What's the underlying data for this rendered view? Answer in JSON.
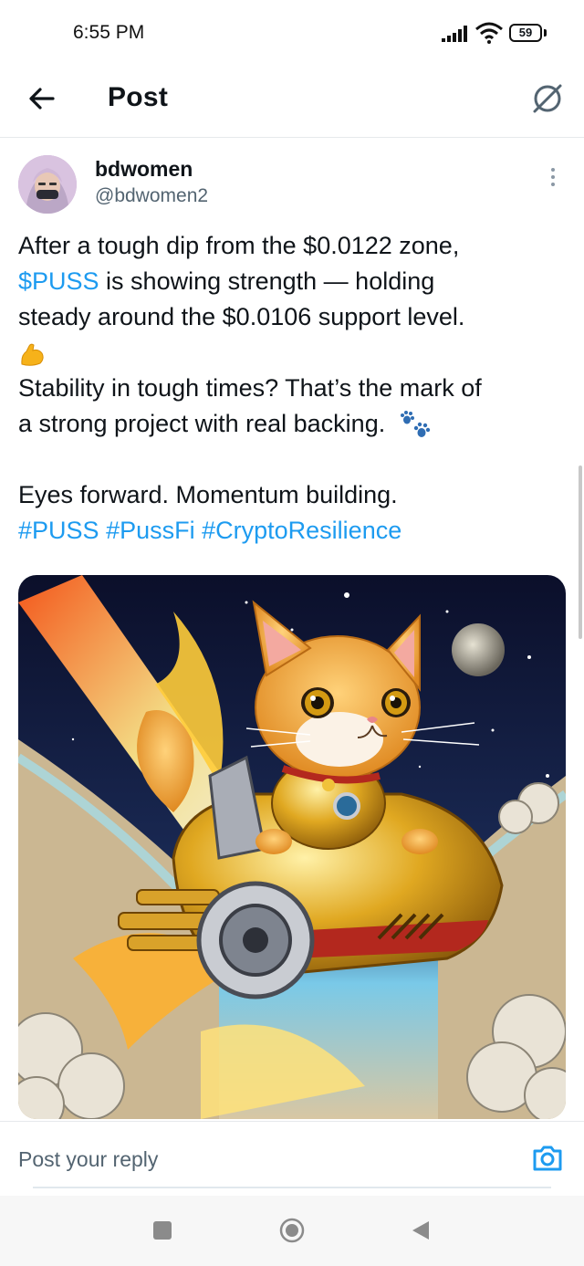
{
  "status_bar": {
    "time": "6:55 PM",
    "battery": "59"
  },
  "header": {
    "title": "Post"
  },
  "author": {
    "name": "bdwomen",
    "handle": "@bdwomen2"
  },
  "tweet": {
    "line1": "After a tough dip from the $0.0122 zone,",
    "cashtag": "$PUSS",
    "line2_rest": " is showing strength — holding",
    "line3": "steady around the $0.0106 support level.",
    "line4": "Stability in tough times? That’s the mark of",
    "line5": "a strong project with real backing.",
    "line6": "Eyes forward. Momentum building.",
    "hashtags": [
      "#PUSS",
      "#PussFi",
      "#CryptoResilience"
    ]
  },
  "reply": {
    "placeholder": "Post your reply"
  },
  "icons": {
    "back": "arrow-left-icon",
    "grok": "grok-icon",
    "more": "more-vertical-icon",
    "camera": "camera-icon",
    "flexed_biceps": "flexed-biceps-emoji",
    "paw_prints": "paw-prints-emoji"
  },
  "colors": {
    "link": "#1d9bf0",
    "text": "#0f1419",
    "secondary": "#536471"
  }
}
